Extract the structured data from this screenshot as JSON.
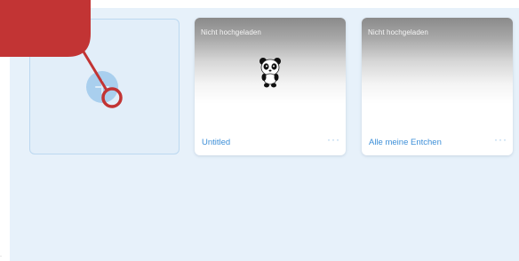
{
  "projects": [
    {
      "status": "Nicht hochgeladen",
      "title": "Untitled",
      "thumbnail": "panda-sprite",
      "menu_icon": "more-dots-icon"
    },
    {
      "status": "Nicht hochgeladen",
      "title": "Alle meine Entchen",
      "thumbnail": "empty",
      "menu_icon": "more-dots-icon"
    }
  ],
  "new_project": {
    "icon": "plus-icon"
  },
  "more_label": "···",
  "colors": {
    "panel_background": "#e7f1fa",
    "accent_blue": "#3d8fd8",
    "annotation_red": "#c23434"
  }
}
